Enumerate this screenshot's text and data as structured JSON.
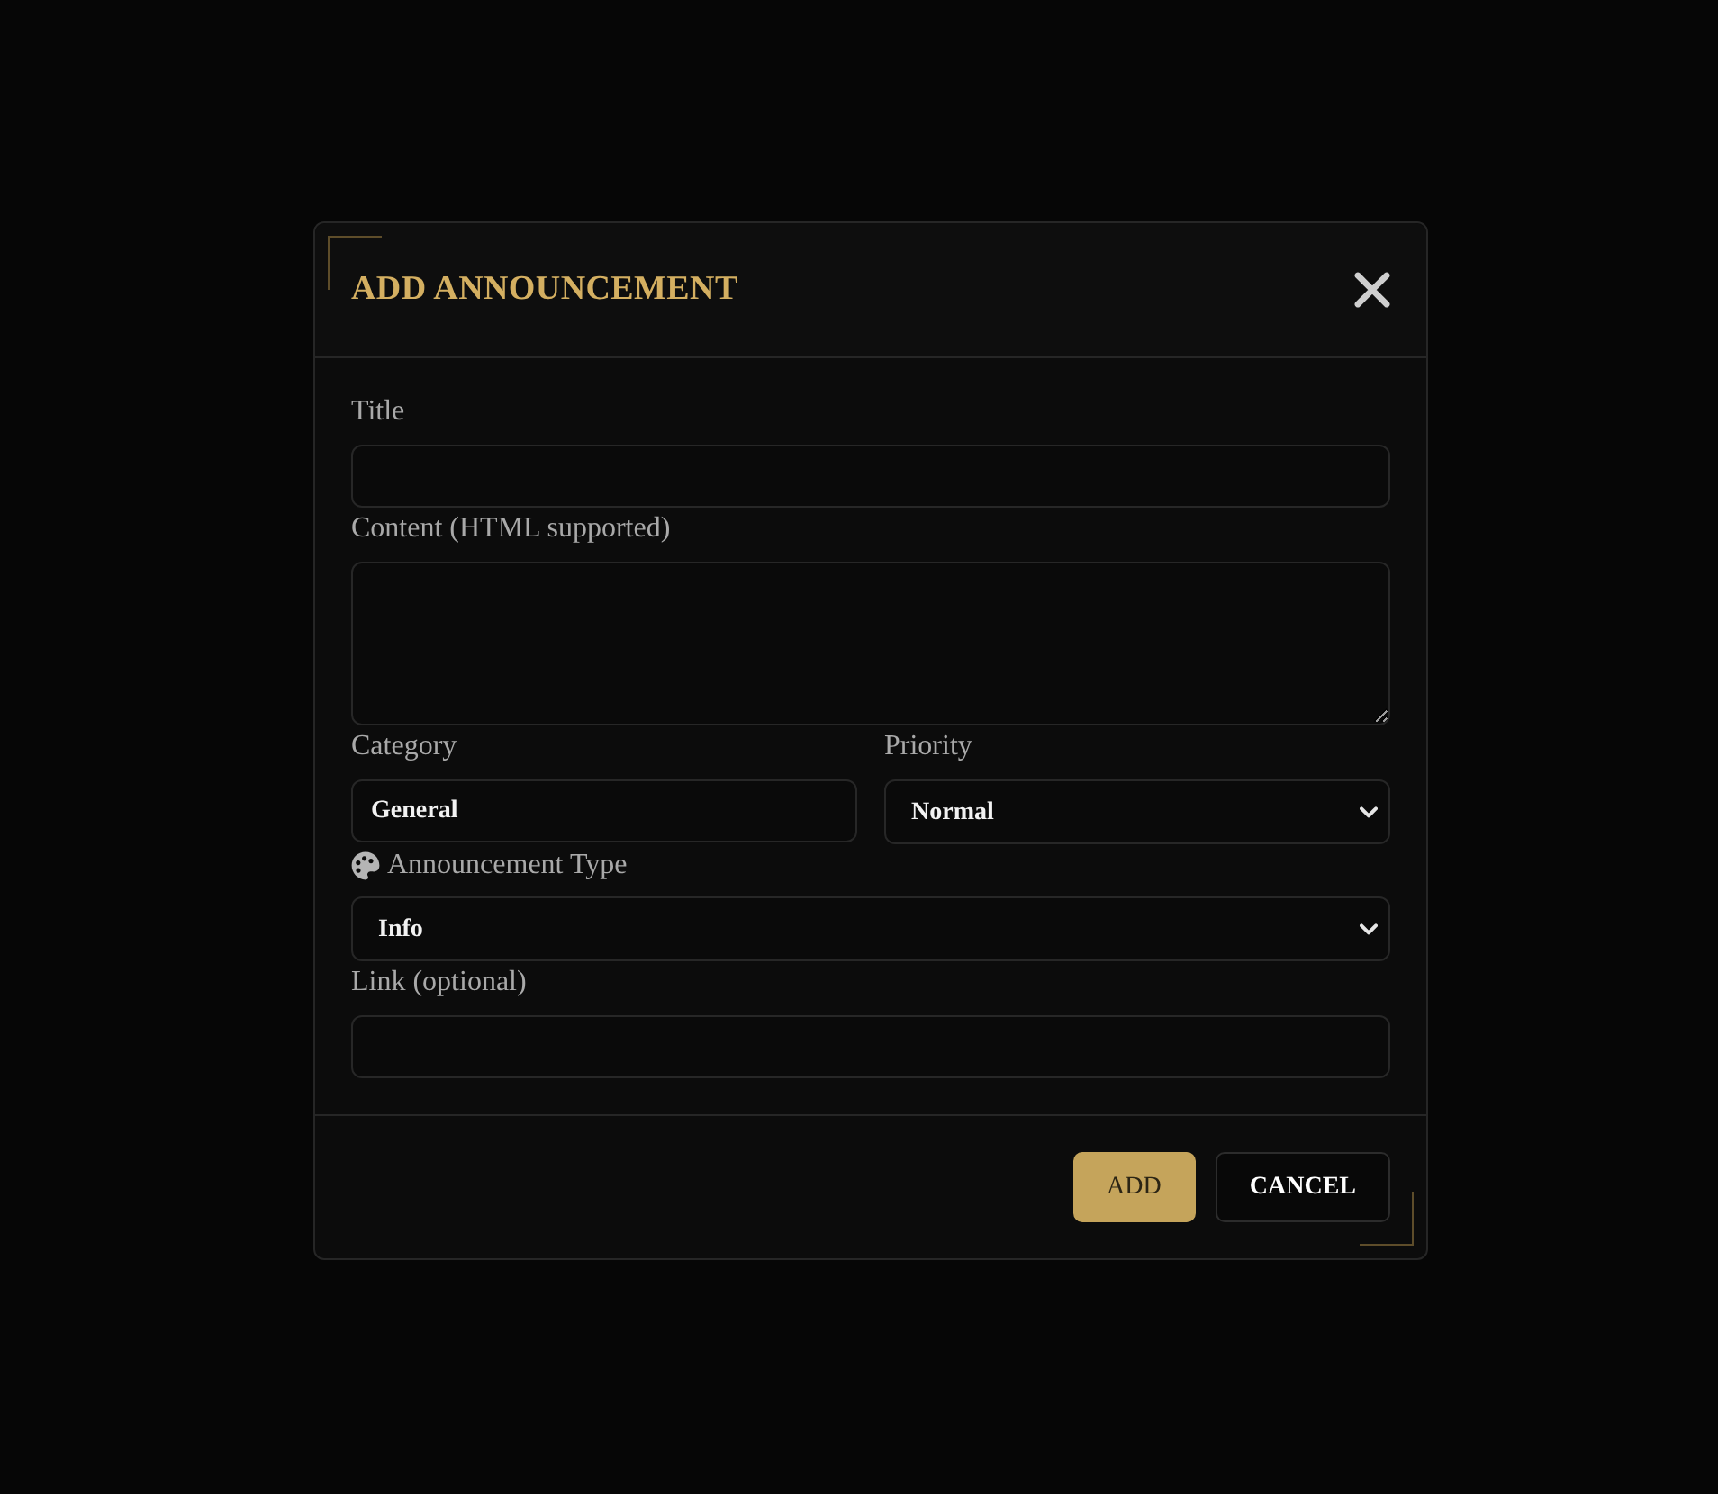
{
  "modal": {
    "title": "ADD ANNOUNCEMENT"
  },
  "rows": [
    [
      {
        "kind": "text",
        "label": "Title"
      }
    ],
    [
      {
        "kind": "textarea",
        "label": "Content (HTML supported)"
      }
    ],
    [
      {
        "kind": "text",
        "label": "Category",
        "value": "General"
      },
      {
        "kind": "select",
        "label": "Priority",
        "value": "Normal"
      }
    ],
    [
      {
        "kind": "select",
        "label": "Announcement Type",
        "value": "Info",
        "icon": true
      }
    ],
    [
      {
        "kind": "text",
        "label": "Link (optional)"
      }
    ]
  ],
  "buttons": [
    {
      "kind": "primary",
      "label": "ADD"
    },
    {
      "kind": "secondary",
      "label": "CANCEL"
    }
  ]
}
